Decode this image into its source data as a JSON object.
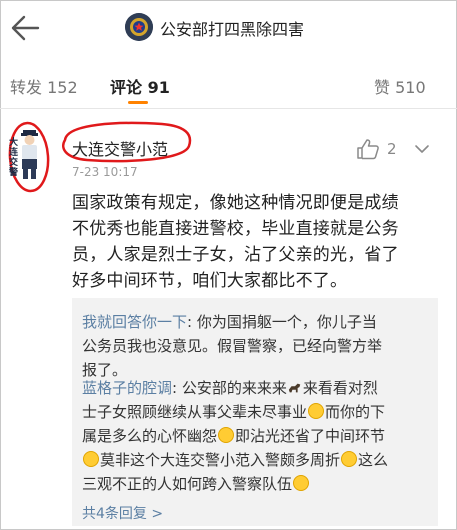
{
  "header": {
    "title": "公安部打四黑除四害",
    "back_icon": "arrow-left-icon",
    "avatar_icon": "police-badge-icon"
  },
  "tabs": [
    {
      "label": "转发",
      "count": "152"
    },
    {
      "label": "评论",
      "count": "91",
      "active": true
    },
    {
      "label": "赞",
      "count": "510"
    }
  ],
  "comment": {
    "author": "大连交警小范",
    "avatar_text": "大连交警",
    "timestamp": "7-23 10:17",
    "likes": "2",
    "text_lines": [
      "国家政策有规定，像她这种情况即便是成绩",
      "不优秀也能直接进警校，毕业直接就是公务",
      "员，人家是烈士子女，沾了父亲的光，省了",
      "好多中间环节，咱们大家都比不了。"
    ]
  },
  "replies": [
    {
      "author": "我就回答你一下",
      "lines": [
        ": 你为国捐躯一个，你儿子当",
        "公务员我也没意见。假冒警察，已经向警方举",
        "报了。"
      ]
    },
    {
      "author": "蓝格子的腔调",
      "lines": [
        ": 公安部的来来来",
        "来看看对烈",
        "士子女照顾继续从事父辈未尽事业",
        "而你的下",
        "属是多么的心怀幽怨",
        "即沾光还省了中间环节",
        "莫非这个大连交警小范入警颇多周折",
        "这么",
        "三观不正的人如何跨入警察队伍"
      ]
    }
  ],
  "more_replies": "共4条回复 >",
  "colors": {
    "accent": "#ff8200",
    "link": "#5b7fa3",
    "annotation": "#e0191b",
    "reply_bg": "#f2f2f2"
  }
}
